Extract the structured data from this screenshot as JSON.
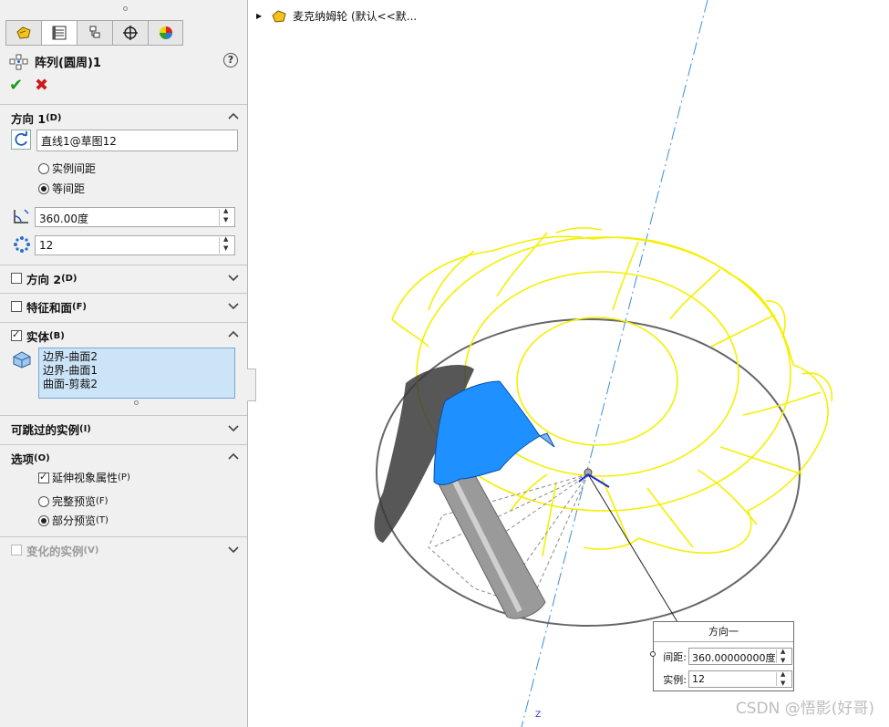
{
  "panel": {
    "tabs": [
      {
        "icon": "feature-manager-icon",
        "active": false
      },
      {
        "icon": "property-manager-icon",
        "active": true
      },
      {
        "icon": "configuration-manager-icon",
        "active": false
      },
      {
        "icon": "dimxpert-icon",
        "active": false
      },
      {
        "icon": "display-manager-icon",
        "active": false
      }
    ],
    "title": "阵列(圆周)1",
    "help_label": "?",
    "ok_label": "✔",
    "cancel_label": "✖",
    "direction1": {
      "header": "方向 1",
      "header_key": "(D)",
      "axis_value": "直线1@草图12",
      "radio_instance_spacing": "实例间距",
      "radio_equal_spacing": "等间距",
      "selected_spacing": "等间距",
      "angle_value": "360.00度",
      "count_value": "12"
    },
    "direction2": {
      "header": "方向 2",
      "header_key": "(D)",
      "checked": false
    },
    "features_faces": {
      "header": "特征和面",
      "header_key": "(F)",
      "checked": false
    },
    "bodies": {
      "header": "实体",
      "header_key": "(B)",
      "checked": true,
      "items": [
        "边界-曲面2",
        "边界-曲面1",
        "曲面-剪裁2"
      ]
    },
    "skip_instances": {
      "header": "可跳过的实例",
      "header_key": "(I)"
    },
    "options": {
      "header": "选项",
      "header_key": "(O)",
      "propagate_visual": "延伸视象属性",
      "propagate_visual_key": "(P)",
      "propagate_checked": true,
      "full_preview": "完整预览",
      "full_preview_key": "(F)",
      "partial_preview": "部分预览",
      "partial_preview_key": "(T)",
      "selected_preview": "部分预览"
    },
    "varied_instances": {
      "header": "变化的实例",
      "header_key": "(V)",
      "checked": false,
      "disabled": true
    }
  },
  "viewport": {
    "tree_item": "麦克纳姆轮 (默认<<默...",
    "popup": {
      "title": "方向一",
      "spacing_label": "间距:",
      "spacing_value": "360.00000000度",
      "count_label": "实例:",
      "count_value": "12"
    },
    "axis_label": "Z",
    "watermark": "CSDN @悟影(好哥)"
  },
  "colors": {
    "preview_wireframe": "#f4f000",
    "selected_surface": "#1e90ff",
    "axis_line": "#3d8fd6",
    "ok_green": "#1a9b1a",
    "cancel_red": "#cc1a1a"
  }
}
